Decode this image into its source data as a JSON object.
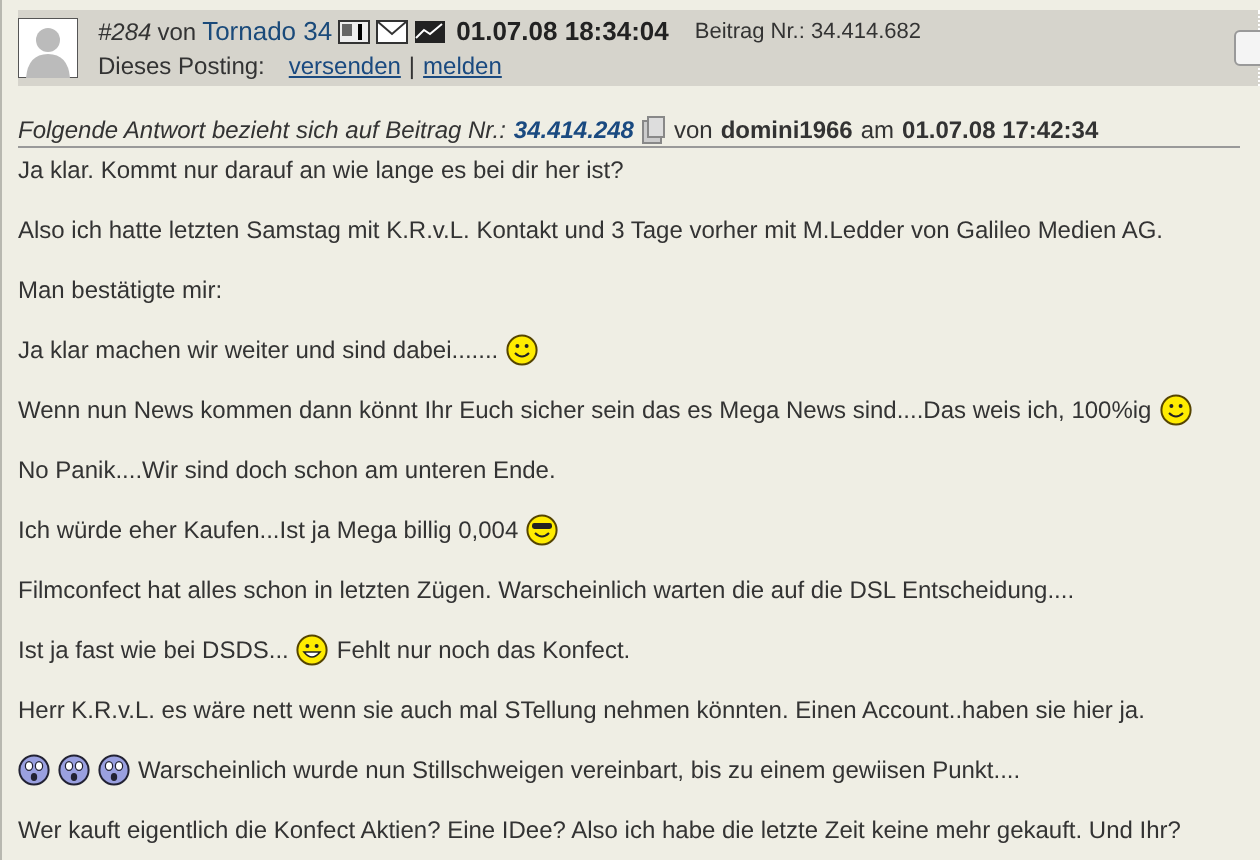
{
  "post": {
    "number": "#284",
    "von": "von",
    "author": "Tornado 34",
    "datetime": "01.07.08 18:34:04",
    "beitrag_label": "Beitrag Nr.:",
    "beitrag_nr": "34.414.682",
    "posting_label": "Dieses Posting:",
    "links": [
      "versenden",
      "melden"
    ],
    "separator": "|"
  },
  "reply_ref": {
    "prefix": "Folgende Antwort bezieht sich auf Beitrag Nr.:",
    "number": "34.414.248",
    "von": "von",
    "user": "domini1966",
    "am": "am",
    "datetime": "01.07.08 17:42:34"
  },
  "paragraphs": [
    [
      {
        "kind": "text",
        "text": "Ja klar. Kommt nur darauf an wie lange es bei dir her ist?"
      }
    ],
    [
      {
        "kind": "text",
        "text": "Also ich hatte letzten Samstag mit K.R.v.L. Kontakt und 3 Tage vorher mit M.Ledder von Galileo Medien AG."
      }
    ],
    [
      {
        "kind": "text",
        "text": "Man bestätigte mir:"
      }
    ],
    [
      {
        "kind": "text",
        "text": "Ja klar machen wir weiter und sind dabei......."
      },
      {
        "kind": "smile"
      }
    ],
    [
      {
        "kind": "text",
        "text": "Wenn nun News kommen dann könnt Ihr Euch sicher sein das es Mega News sind....Das weis ich, 100%ig"
      },
      {
        "kind": "smile"
      }
    ],
    [
      {
        "kind": "text",
        "text": "No Panik....Wir sind doch schon am unteren Ende."
      }
    ],
    [
      {
        "kind": "text",
        "text": "Ich würde eher Kaufen...Ist ja Mega billig 0,004"
      },
      {
        "kind": "cool"
      }
    ],
    [
      {
        "kind": "text",
        "text": "Filmconfect hat alles schon in letzten Zügen. Warscheinlich warten die auf die DSL Entscheidung...."
      }
    ],
    [
      {
        "kind": "text",
        "text": "Ist ja fast wie bei DSDS..."
      },
      {
        "kind": "grin"
      },
      {
        "kind": "text",
        "text": "Fehlt nur noch das Konfect."
      }
    ],
    [
      {
        "kind": "text",
        "text": "Herr K.R.v.L. es wäre nett wenn sie auch mal STellung nehmen könnten. Einen Account..haben sie hier ja."
      }
    ],
    [
      {
        "kind": "shock"
      },
      {
        "kind": "shock"
      },
      {
        "kind": "shock"
      },
      {
        "kind": "text",
        "text": "Warscheinlich wurde nun Stillschweigen vereinbart, bis zu einem gewiisen Punkt...."
      }
    ],
    [
      {
        "kind": "text",
        "text": "Wer kauft eigentlich die Konfect Aktien? Eine IDee? Also ich habe die letzte Zeit keine mehr gekauft. Und Ihr?"
      }
    ]
  ]
}
